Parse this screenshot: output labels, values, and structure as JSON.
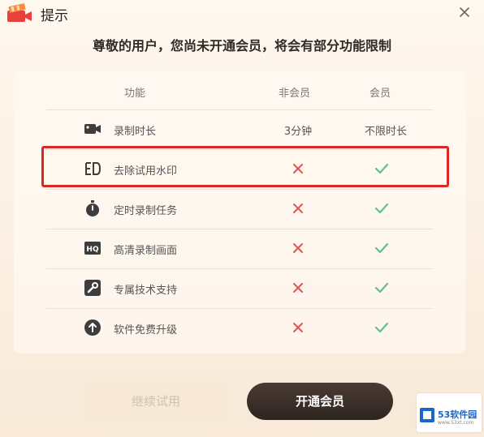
{
  "window": {
    "title": "提示",
    "app_icon": "video-camera-app-icon",
    "close_icon": "close-icon"
  },
  "headline": "尊敬的用户，您尚未开通会员，将会有部分功能限制",
  "table": {
    "headers": {
      "feature": "功能",
      "non_member": "非会员",
      "member": "会员"
    },
    "rows": [
      {
        "icon": "video-camera-icon",
        "label": "录制时长",
        "non_member": "3分钟",
        "member": "不限时长"
      },
      {
        "icon": "watermark-icon",
        "label": "去除试用水印",
        "non_member": "cross",
        "member": "check",
        "highlighted": true
      },
      {
        "icon": "timer-icon",
        "label": "定时录制任务",
        "non_member": "cross",
        "member": "check"
      },
      {
        "icon": "hq-icon",
        "label": "高清录制画面",
        "non_member": "cross",
        "member": "check"
      },
      {
        "icon": "wrench-icon",
        "label": "专属技术支持",
        "non_member": "cross",
        "member": "check"
      },
      {
        "icon": "upgrade-icon",
        "label": "软件免费升级",
        "non_member": "cross",
        "member": "check"
      }
    ]
  },
  "buttons": {
    "continue_trial": "继续试用",
    "become_member": "开通会员"
  },
  "watermark": {
    "text": "53软件园",
    "url": "www.53xt.com"
  },
  "colors": {
    "cross": "#e25555",
    "check": "#5ec28a",
    "highlight_border": "#d92828",
    "primary_button": "#2e2520"
  }
}
